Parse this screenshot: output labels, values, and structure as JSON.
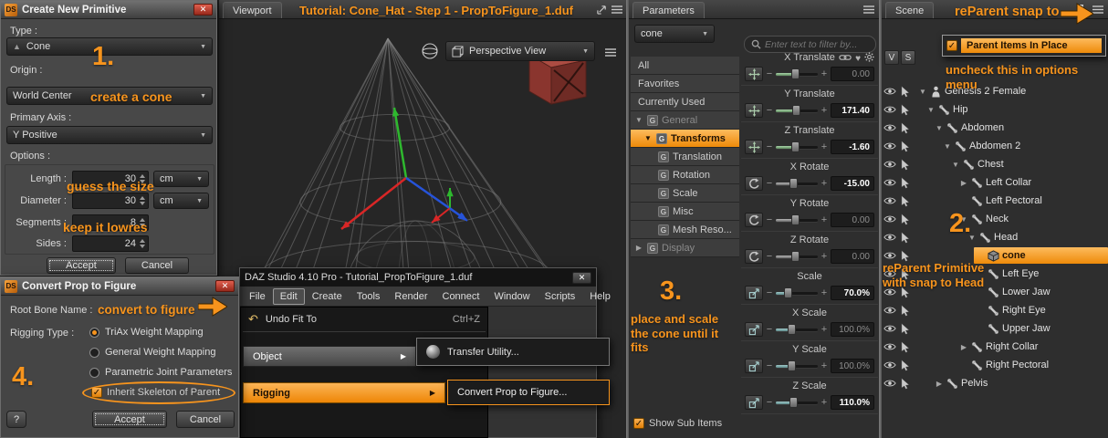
{
  "branding": {
    "logo": "DS"
  },
  "icons": {
    "check": "✓",
    "caret_down": "▼",
    "caret_right": "▶",
    "close": "✕",
    "minus": "−",
    "plus": "+",
    "undo": "↶",
    "menu_arrow": "▶",
    "cone_glyph": "▲",
    "heart": "♥"
  },
  "create_primitive": {
    "title": "Create New Primitive",
    "fields": {
      "type_label": "Type :",
      "type_value": "Cone",
      "origin_label": "Origin :",
      "origin_value": "World Center",
      "axis_label": "Primary Axis :",
      "axis_value": "Y Positive",
      "options_label": "Options :",
      "length_label": "Length :",
      "length_value": "30",
      "length_unit": "cm",
      "diameter_label": "Diameter :",
      "diameter_value": "30",
      "diameter_unit": "cm",
      "segments_label": "Segments :",
      "segments_value": "8",
      "sides_label": "Sides :",
      "sides_value": "24"
    },
    "accept_label": "Accept",
    "cancel_label": "Cancel",
    "annotations": {
      "step": "1.",
      "create_cone": "create a cone",
      "guess_size": "guess the size",
      "lowres": "keep it lowres"
    }
  },
  "convert_prop": {
    "title": "Convert Prop to Figure",
    "root_bone_label": "Root Bone Name :",
    "rigging_type_label": "Rigging Type :",
    "rigging_options": [
      {
        "label": "TriAx Weight Mapping",
        "selected": true
      },
      {
        "label": "General Weight Mapping",
        "selected": false
      },
      {
        "label": "Parametric Joint Parameters",
        "selected": false
      }
    ],
    "inherit_label": "Inherit Skeleton of Parent",
    "help_label": "?",
    "accept_label": "Accept",
    "cancel_label": "Cancel",
    "annotations": {
      "step": "4.",
      "convert": "convert to figure"
    }
  },
  "viewport": {
    "tab_label": "Viewport",
    "title": "Tutorial: Cone_Hat - Step 1 - PropToFigure_1.duf",
    "view_selector": "Perspective View"
  },
  "daz_window": {
    "title": "DAZ Studio 4.10 Pro - Tutorial_PropToFigure_1.duf",
    "menus": [
      "File",
      "Edit",
      "Create",
      "Tools",
      "Render",
      "Connect",
      "Window",
      "Scripts",
      "Help"
    ],
    "active_menu": "Edit",
    "undo_label": "Undo Fit To",
    "undo_shortcut": "Ctrl+Z",
    "object_label": "Object",
    "transfer_label": "Transfer Utility...",
    "rigging_label": "Rigging",
    "convert_label": "Convert Prop to Figure..."
  },
  "parameters": {
    "tab_label": "Parameters",
    "node_selector": "cone",
    "filter_placeholder": "Enter text to filter by...",
    "nav": [
      {
        "label": "All",
        "type": "plain"
      },
      {
        "label": "Favorites",
        "type": "plain"
      },
      {
        "label": "Currently Used",
        "type": "plain"
      },
      {
        "label": "General",
        "type": "group",
        "arrow": "down",
        "dim": true
      },
      {
        "label": "Transforms",
        "type": "group",
        "arrow": "down",
        "selected": true
      },
      {
        "label": "Translation",
        "type": "group"
      },
      {
        "label": "Rotation",
        "type": "group"
      },
      {
        "label": "Scale",
        "type": "group"
      },
      {
        "label": "Misc",
        "type": "group"
      },
      {
        "label": "Mesh Reso...",
        "type": "group"
      },
      {
        "label": "Display",
        "type": "group",
        "arrow": "right",
        "dim": true
      }
    ],
    "sliders": [
      {
        "label": "X Translate",
        "value": "0.00",
        "kind": "translate",
        "pct": 46,
        "modified": false,
        "extra_icons": true
      },
      {
        "label": "Y Translate",
        "value": "171.40",
        "kind": "translate",
        "pct": 48,
        "modified": true
      },
      {
        "label": "Z Translate",
        "value": "-1.60",
        "kind": "translate",
        "pct": 45,
        "modified": true
      },
      {
        "label": "X Rotate",
        "value": "-15.00",
        "kind": "rotate",
        "pct": 41,
        "modified": true
      },
      {
        "label": "Y Rotate",
        "value": "0.00",
        "kind": "rotate",
        "pct": 46,
        "modified": false
      },
      {
        "label": "Z Rotate",
        "value": "0.00",
        "kind": "rotate",
        "pct": 46,
        "modified": false
      },
      {
        "label": "Scale",
        "value": "70.0%",
        "kind": "scale",
        "pct": 28,
        "modified": true
      },
      {
        "label": "X Scale",
        "value": "100.0%",
        "kind": "scale",
        "pct": 37,
        "modified": false
      },
      {
        "label": "Y Scale",
        "value": "100.0%",
        "kind": "scale",
        "pct": 37,
        "modified": false
      },
      {
        "label": "Z Scale",
        "value": "110.0%",
        "kind": "scale",
        "pct": 41,
        "modified": true
      }
    ],
    "show_sub_items_label": "Show Sub Items",
    "annotations": {
      "step": "3.",
      "note": "place and scale the cone until it fits"
    }
  },
  "scene": {
    "tab_label": "Scene",
    "col_v": "V",
    "col_s": "S",
    "context_menu": {
      "label": "Parent Items In Place",
      "checked": true
    },
    "tree": [
      {
        "label": "Genesis 2 Female",
        "indent": 0,
        "arrow": "down",
        "icon": "figure"
      },
      {
        "label": "Hip",
        "indent": 1,
        "arrow": "down",
        "icon": "bone"
      },
      {
        "label": "Abdomen",
        "indent": 2,
        "arrow": "down",
        "icon": "bone"
      },
      {
        "label": "Abdomen 2",
        "indent": 3,
        "arrow": "down",
        "icon": "bone"
      },
      {
        "label": "Chest",
        "indent": 4,
        "arrow": "down",
        "icon": "bone"
      },
      {
        "label": "Left Collar",
        "indent": 5,
        "arrow": "right",
        "icon": "bone"
      },
      {
        "label": "Left Pectoral",
        "indent": 5,
        "arrow": "none",
        "icon": "bone"
      },
      {
        "label": "Neck",
        "indent": 5,
        "arrow": "down",
        "icon": "bone"
      },
      {
        "label": "Head",
        "indent": 6,
        "arrow": "down",
        "icon": "bone"
      },
      {
        "label": "cone",
        "indent": 7,
        "arrow": "none",
        "icon": "cube",
        "selected": true
      },
      {
        "label": "Left Eye",
        "indent": 7,
        "arrow": "none",
        "icon": "bone"
      },
      {
        "label": "Lower Jaw",
        "indent": 7,
        "arrow": "none",
        "icon": "bone"
      },
      {
        "label": "Right Eye",
        "indent": 7,
        "arrow": "none",
        "icon": "bone"
      },
      {
        "label": "Upper Jaw",
        "indent": 7,
        "arrow": "none",
        "icon": "bone"
      },
      {
        "label": "Right Collar",
        "indent": 5,
        "arrow": "right",
        "icon": "bone"
      },
      {
        "label": "Right Pectoral",
        "indent": 5,
        "arrow": "none",
        "icon": "bone"
      },
      {
        "label": "Pelvis",
        "indent": 2,
        "arrow": "right",
        "icon": "bone"
      }
    ],
    "annotations": {
      "reparent_top": "reParent snap to",
      "uncheck": "uncheck this in options menu",
      "step": "2.",
      "reparent_note": "reParent Primitive with snap to Head"
    }
  }
}
